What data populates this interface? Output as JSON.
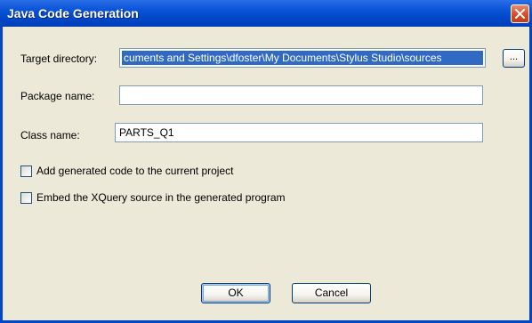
{
  "window": {
    "title": "Java Code Generation",
    "close_icon": "close-icon"
  },
  "form": {
    "target_directory": {
      "label": "Target directory:",
      "value": "cuments and Settings\\dfoster\\My Documents\\Stylus Studio\\sources"
    },
    "browse_label": "...",
    "package_name": {
      "label": "Package name:",
      "value": ""
    },
    "class_name": {
      "label": "Class name:",
      "value": "PARTS_Q1"
    }
  },
  "options": {
    "add_to_project": {
      "label": "Add generated code to the current project",
      "checked": false
    },
    "embed_xquery": {
      "label": "Embed the XQuery source in the generated program",
      "checked": false
    }
  },
  "buttons": {
    "ok": "OK",
    "cancel": "Cancel"
  },
  "colors": {
    "titlebar": "#0047c9",
    "dialog_bg": "#ece9d8",
    "selection": "#316ac5",
    "close_button": "#d8502f"
  }
}
